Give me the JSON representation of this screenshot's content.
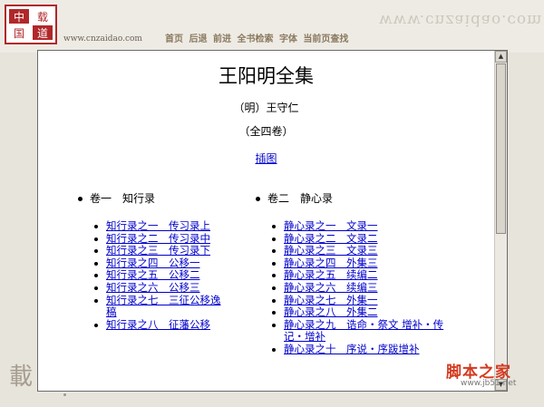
{
  "site": {
    "logo_chars": [
      "中",
      "载",
      "国",
      "道"
    ],
    "url": "www.cnzaidao.com",
    "watermark": "www.cnzaidao.com"
  },
  "toolbar": [
    "首页",
    "后退",
    "前进",
    "全书检索",
    "字体",
    "当前页查找"
  ],
  "book": {
    "title": "王阳明全集",
    "author": "（明）王守仁",
    "volumes_note": "（全四卷）",
    "illustrations_link": "插图"
  },
  "volume1": {
    "label": "卷一　知行录",
    "chapters": [
      "知行录之一　传习录上",
      "知行录之二　传习录中",
      "知行录之三　传习录下",
      "知行录之四　公移一",
      "知行录之五　公移二",
      "知行录之六　公移三",
      "知行录之七　三征公移逸稿",
      "知行录之八　征藩公移"
    ]
  },
  "volume2": {
    "label": "卷二　静心录",
    "chapters": [
      "静心录之一　文录一",
      "静心录之二　文录二",
      "静心录之三　文录三",
      "静心录之四　外集三",
      "静心录之五　续编二",
      "静心录之六　续编三",
      "静心录之七　外集一",
      "静心录之八　外集二",
      "静心录之九　诰命・祭文 增补・传记・增补",
      "静心录之十　序说・序跋增补"
    ]
  },
  "deco": {
    "left_char": "載"
  },
  "corner_watermark": {
    "brand": "脚本之家",
    "url": "www.jb51.net"
  },
  "colors": {
    "link": "#0000cc",
    "toolbar": "#8a7a60",
    "logo_red": "#b0282a"
  }
}
